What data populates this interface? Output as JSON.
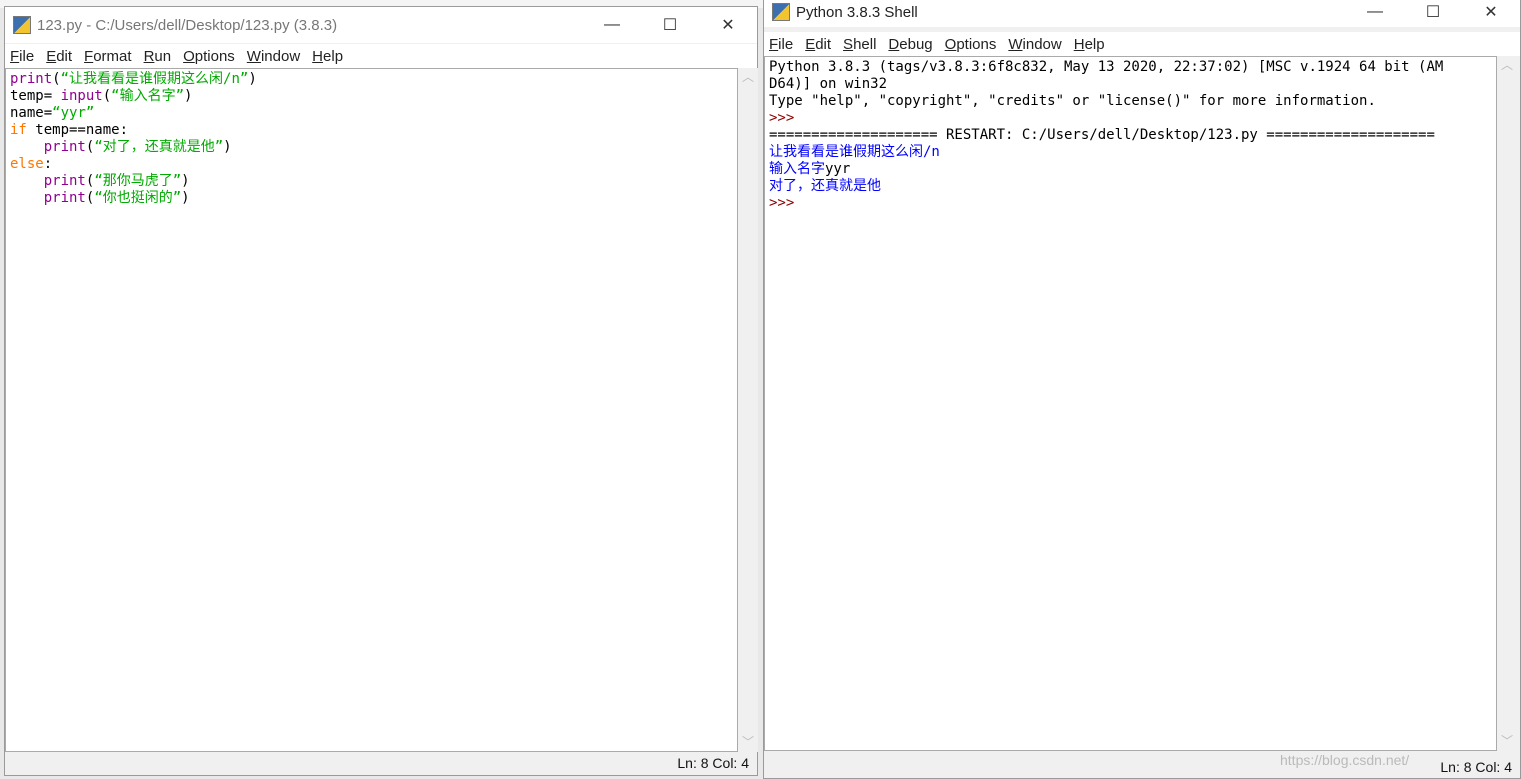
{
  "editor": {
    "title": "123.py - C:/Users/dell/Desktop/123.py (3.8.3)",
    "menus": [
      "File",
      "Edit",
      "Format",
      "Run",
      "Options",
      "Window",
      "Help"
    ],
    "code": [
      [
        {
          "t": "print",
          "c": "bi"
        },
        {
          "t": "(",
          "c": ""
        },
        {
          "t": "“让我看看是谁假期这么闲/n”",
          "c": "st"
        },
        {
          "t": ")",
          "c": ""
        }
      ],
      [
        {
          "t": "temp= ",
          "c": ""
        },
        {
          "t": "input",
          "c": "bi"
        },
        {
          "t": "(",
          "c": ""
        },
        {
          "t": "“输入名字”",
          "c": "st"
        },
        {
          "t": ")",
          "c": ""
        }
      ],
      [
        {
          "t": "name=",
          "c": ""
        },
        {
          "t": "“yyr”",
          "c": "st"
        }
      ],
      [
        {
          "t": "if",
          "c": "kw"
        },
        {
          "t": " temp==name:",
          "c": ""
        }
      ],
      [
        {
          "t": "    ",
          "c": ""
        },
        {
          "t": "print",
          "c": "bi"
        },
        {
          "t": "(",
          "c": ""
        },
        {
          "t": "“对了，还真就是他”",
          "c": "st"
        },
        {
          "t": ")",
          "c": ""
        }
      ],
      [
        {
          "t": "else",
          "c": "kw"
        },
        {
          "t": ":",
          "c": ""
        }
      ],
      [
        {
          "t": "    ",
          "c": ""
        },
        {
          "t": "print",
          "c": "bi"
        },
        {
          "t": "(",
          "c": ""
        },
        {
          "t": "“那你马虎了”",
          "c": "st"
        },
        {
          "t": ")",
          "c": ""
        }
      ],
      [
        {
          "t": "    ",
          "c": ""
        },
        {
          "t": "print",
          "c": "bi"
        },
        {
          "t": "(",
          "c": ""
        },
        {
          "t": "“你也挺闲的”",
          "c": "st"
        },
        {
          "t": ")",
          "c": ""
        }
      ]
    ],
    "status": "Ln: 8  Col: 4"
  },
  "shell": {
    "title": "Python 3.8.3 Shell",
    "menus": [
      "File",
      "Edit",
      "Shell",
      "Debug",
      "Options",
      "Window",
      "Help"
    ],
    "lines": [
      {
        "t": "Python 3.8.3 (tags/v3.8.3:6f8c832, May 13 2020, 22:37:02) [MSC v.1924 64 bit (AM",
        "c": ""
      },
      {
        "t": "D64)] on win32",
        "c": ""
      },
      {
        "t": "Type \"help\", \"copyright\", \"credits\" or \"license()\" for more information.",
        "c": ""
      },
      {
        "t": ">>> ",
        "c": "pr"
      },
      {
        "t": "==================== RESTART: C:/Users/dell/Desktop/123.py ====================",
        "c": ""
      },
      {
        "t": "让我看看是谁假期这么闲/n",
        "c": "out"
      },
      {
        "t": "输入名字",
        "c": "out",
        "extra": "yyr"
      },
      {
        "t": "对了，还真就是他",
        "c": "out"
      },
      {
        "t": ">>> ",
        "c": "pr"
      }
    ],
    "status": "Ln: 8  Col: 4"
  },
  "watermark": "https://blog.csdn.net/",
  "window_buttons": {
    "min": "—",
    "max": "☐",
    "close": "✕"
  }
}
